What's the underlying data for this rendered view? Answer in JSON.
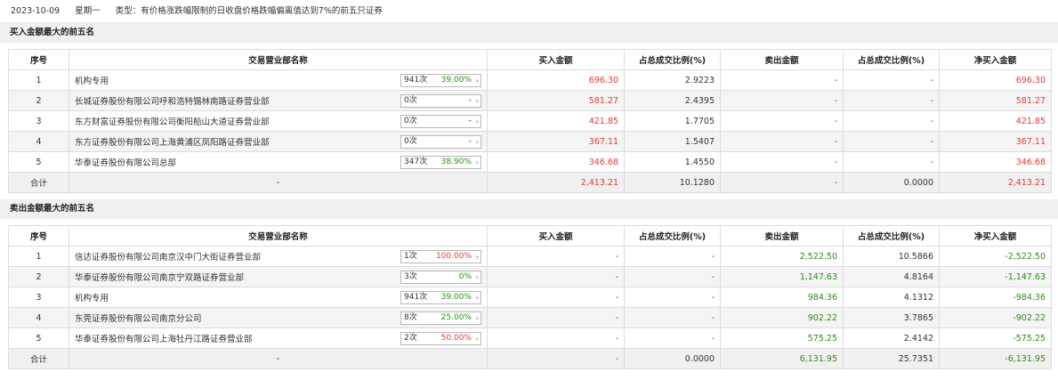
{
  "header": {
    "date": "2023-10-09",
    "weekday": "星期一",
    "type_text": "类型：有价格涨跌幅限制的日收盘价格跌幅偏离值达到7%的前五只证券"
  },
  "columns": {
    "seq": "序号",
    "name": "交易营业部名称",
    "buy": "买入金额",
    "buy_ratio": "占总成交比例(%)",
    "sell": "卖出金额",
    "sell_ratio": "占总成交比例(%)",
    "net": "净买入金额"
  },
  "buy_section": {
    "title": "买入金额最大的前五名",
    "rows": [
      {
        "seq": "1",
        "name": "机构专用",
        "count": "941次",
        "pct": "39.00%",
        "pct_color": "g",
        "buy": "696.30",
        "buy_ratio": "2.9223",
        "sell": "-",
        "sell_ratio": "-",
        "net": "696.30"
      },
      {
        "seq": "2",
        "name": "长城证券股份有限公司呼和浩特锡林南路证券营业部",
        "count": "0次",
        "pct": "-",
        "pct_color": "k",
        "buy": "581.27",
        "buy_ratio": "2.4395",
        "sell": "-",
        "sell_ratio": "-",
        "net": "581.27"
      },
      {
        "seq": "3",
        "name": "东方财富证券股份有限公司衡阳船山大道证券营业部",
        "count": "0次",
        "pct": "-",
        "pct_color": "k",
        "buy": "421.85",
        "buy_ratio": "1.7705",
        "sell": "-",
        "sell_ratio": "-",
        "net": "421.85"
      },
      {
        "seq": "4",
        "name": "东方证券股份有限公司上海黄浦区凤阳路证券营业部",
        "count": "0次",
        "pct": "-",
        "pct_color": "k",
        "buy": "367.11",
        "buy_ratio": "1.5407",
        "sell": "-",
        "sell_ratio": "-",
        "net": "367.11"
      },
      {
        "seq": "5",
        "name": "华泰证券股份有限公司总部",
        "count": "347次",
        "pct": "38.90%",
        "pct_color": "g",
        "buy": "346.68",
        "buy_ratio": "1.4550",
        "sell": "-",
        "sell_ratio": "-",
        "net": "346.68"
      }
    ],
    "total": {
      "label": "合计",
      "name": "-",
      "buy": "2,413.21",
      "buy_ratio": "10.1280",
      "sell": "-",
      "sell_ratio": "0.0000",
      "net": "2,413.21"
    }
  },
  "sell_section": {
    "title": "卖出金额最大的前五名",
    "rows": [
      {
        "seq": "1",
        "name": "信达证券股份有限公司南京汉中门大街证券营业部",
        "count": "1次",
        "pct": "100.00%",
        "pct_color": "r",
        "buy": "-",
        "buy_ratio": "-",
        "sell": "2,522.50",
        "sell_ratio": "10.5866",
        "net": "-2,522.50"
      },
      {
        "seq": "2",
        "name": "华泰证券股份有限公司南京宁双路证券营业部",
        "count": "3次",
        "pct": "0%",
        "pct_color": "g",
        "buy": "-",
        "buy_ratio": "-",
        "sell": "1,147.63",
        "sell_ratio": "4.8164",
        "net": "-1,147.63"
      },
      {
        "seq": "3",
        "name": "机构专用",
        "count": "941次",
        "pct": "39.00%",
        "pct_color": "g",
        "buy": "-",
        "buy_ratio": "-",
        "sell": "984.36",
        "sell_ratio": "4.1312",
        "net": "-984.36"
      },
      {
        "seq": "4",
        "name": "东莞证券股份有限公司南京分公司",
        "count": "8次",
        "pct": "25.00%",
        "pct_color": "g",
        "buy": "-",
        "buy_ratio": "-",
        "sell": "902.22",
        "sell_ratio": "3.7865",
        "net": "-902.22"
      },
      {
        "seq": "5",
        "name": "华泰证券股份有限公司上海牡丹江路证券营业部",
        "count": "2次",
        "pct": "50.00%",
        "pct_color": "r",
        "buy": "-",
        "buy_ratio": "-",
        "sell": "575.25",
        "sell_ratio": "2.4142",
        "net": "-575.25"
      }
    ],
    "total": {
      "label": "合计",
      "name": "-",
      "buy": "-",
      "buy_ratio": "0.0000",
      "sell": "6,131.95",
      "sell_ratio": "25.7351",
      "net": "-6,131.95"
    }
  },
  "colors": {
    "positive": "#e53935",
    "negative": "#2e8b1a",
    "section_bg": "#f0f0f0"
  },
  "icons": {
    "dropdown": "chevron-right-icon"
  }
}
